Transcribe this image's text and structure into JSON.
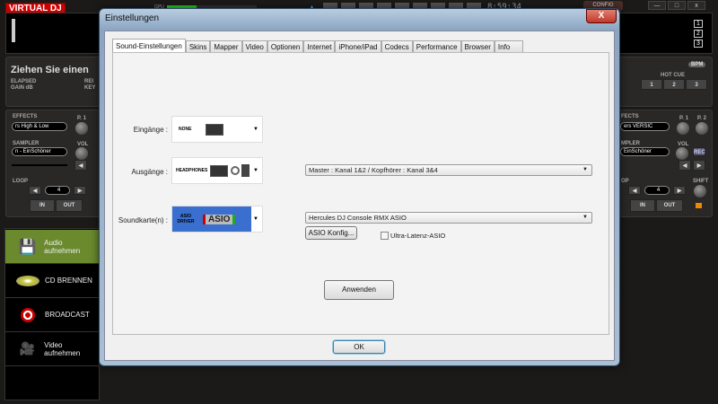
{
  "app": {
    "logo": "VIRTUAL DJ",
    "gpu_label": "GPU",
    "gpu_level": 0.33,
    "clock": "8:59:34",
    "config": "CONFIG",
    "win_buttons": [
      "—",
      "□",
      "x"
    ],
    "deck_numbers": [
      "1",
      "2",
      "3"
    ]
  },
  "deck": {
    "title": "Ziehen Sie einen",
    "elapsed": "ELAPSED",
    "gain": "GAIN dB",
    "rem": "REI",
    "key": "KEY",
    "bpm": "BPM",
    "hot_cue": "HOT CUE",
    "hot_cues": [
      "1",
      "2",
      "3"
    ]
  },
  "left_panel": {
    "effects": "EFFECTS",
    "effect_value": "rs High & Low",
    "p1": "P. 1",
    "sampler": "SAMPLER",
    "sampler_value": "n - EinSchöner",
    "vol": "VOL",
    "loop": "LOOP",
    "loop_value": "4",
    "in": "IN",
    "out": "OUT"
  },
  "right_panel": {
    "effects": "FECTS",
    "effect_value": "ers VERSIC",
    "p1": "P. 1",
    "p2": "P. 2",
    "sampler": "MPLER",
    "sampler_value": "EinSchöner",
    "vol": "VOL",
    "rec": "REC",
    "loop": "OP",
    "loop_value": "4",
    "shift": "SHIFT",
    "in": "IN",
    "out": "OUT"
  },
  "sidebar": [
    {
      "label": "Audio aufnehmen",
      "icon": "floppy-icon",
      "active": true
    },
    {
      "label": "CD BRENNEN",
      "icon": "cd-icon"
    },
    {
      "label": "BROADCAST",
      "icon": "broadcast-icon"
    },
    {
      "label": "Video aufnehmen",
      "icon": "camera-icon"
    }
  ],
  "dialog": {
    "title": "Einstellungen",
    "close": "X",
    "tabs": [
      "Sound-Einstellungen",
      "Skins",
      "Mapper",
      "Video",
      "Optionen",
      "Internet",
      "iPhone/iPad",
      "Codecs",
      "Performance",
      "Browser",
      "Info"
    ],
    "inputs_label": "Eingänge :",
    "inputs_value": "NONE",
    "outputs_label": "Ausgänge :",
    "outputs_value": "HEADPHONES",
    "outputs_combo": "Master : Kanal 1&2 / Kopfhörer : Kanal 3&4",
    "soundcard_label": "Soundkarte(n) :",
    "soundcard_value": "ASIO DRIVER",
    "soundcard_logo": "ASIO",
    "soundcard_combo": "Hercules DJ Console RMX ASIO",
    "asio_config": "ASIO Konfig...",
    "ultra_latency": "Ultra-Latenz-ASIO",
    "ultra_latency_checked": false,
    "apply": "Anwenden",
    "ok": "OK"
  }
}
